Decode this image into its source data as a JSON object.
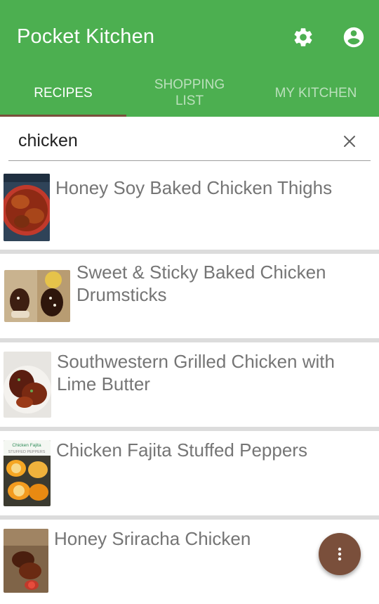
{
  "app": {
    "title": "Pocket Kitchen"
  },
  "toolbar": {
    "settings_icon": "gear-icon",
    "account_icon": "account-circle-icon"
  },
  "tabs": [
    {
      "label": "RECIPES",
      "active": true
    },
    {
      "label_line1": "SHOPPING",
      "label_line2": "LIST",
      "active": false
    },
    {
      "label": "MY KITCHEN",
      "active": false
    }
  ],
  "search": {
    "value": "chicken",
    "clear_icon": "close-icon"
  },
  "recipes": [
    {
      "name": "Honey Soy Baked Chicken Thighs"
    },
    {
      "name": "Sweet & Sticky Baked Chicken Drumsticks"
    },
    {
      "name": "Southwestern Grilled Chicken with Lime Butter"
    },
    {
      "name": "Chicken Fajita Stuffed Peppers",
      "thumb_text_1": "Chicken Fajita",
      "thumb_text_2": "STUFFED PEPPERS"
    },
    {
      "name": "Honey Sriracha Chicken"
    }
  ],
  "fab": {
    "icon": "more-vert-icon"
  },
  "colors": {
    "primary": "#4caf50",
    "accent": "#7a4f3b",
    "text_secondary": "#757575"
  }
}
